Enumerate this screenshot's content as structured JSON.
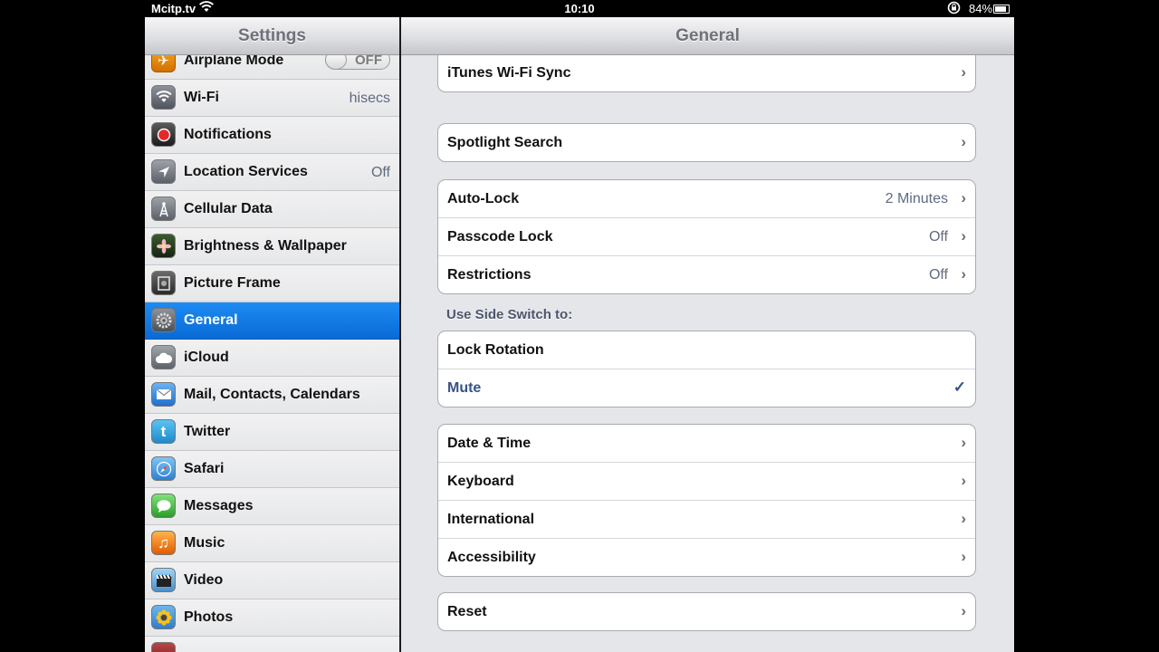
{
  "status_bar": {
    "carrier": "Mcitp.tv",
    "time": "10:10",
    "battery_percent": "84%",
    "battery_level": 0.84,
    "icons": [
      "wifi-icon",
      "rotation-lock-icon",
      "battery-icon"
    ]
  },
  "sidebar": {
    "title": "Settings",
    "items": [
      {
        "label": "Airplane Mode",
        "toggle": "OFF",
        "icon": "airplane-icon"
      },
      {
        "label": "Wi-Fi",
        "value": "hisecs",
        "icon": "wifi-icon"
      },
      {
        "label": "Notifications",
        "icon": "notifications-icon"
      },
      {
        "label": "Location Services",
        "value": "Off",
        "icon": "location-icon"
      },
      {
        "label": "Cellular Data",
        "icon": "antenna-icon"
      },
      {
        "label": "Brightness & Wallpaper",
        "icon": "flower-icon"
      },
      {
        "label": "Picture Frame",
        "icon": "picture-frame-icon"
      },
      {
        "label": "General",
        "icon": "gear-icon",
        "selected": true
      },
      {
        "label": "iCloud",
        "icon": "cloud-icon"
      },
      {
        "label": "Mail, Contacts, Calendars",
        "icon": "mail-icon"
      },
      {
        "label": "Twitter",
        "icon": "twitter-icon"
      },
      {
        "label": "Safari",
        "icon": "compass-icon"
      },
      {
        "label": "Messages",
        "icon": "speech-bubble-icon"
      },
      {
        "label": "Music",
        "icon": "music-icon"
      },
      {
        "label": "Video",
        "icon": "clapperboard-icon"
      },
      {
        "label": "Photos",
        "icon": "sunflower-icon"
      }
    ]
  },
  "detail": {
    "title": "General",
    "group1": [
      {
        "label": "iTunes Wi-Fi Sync"
      }
    ],
    "group2": [
      {
        "label": "Spotlight Search"
      }
    ],
    "group3": [
      {
        "label": "Auto-Lock",
        "value": "2 Minutes"
      },
      {
        "label": "Passcode Lock",
        "value": "Off"
      },
      {
        "label": "Restrictions",
        "value": "Off"
      }
    ],
    "side_switch_header": "Use Side Switch to:",
    "side_switch_options": [
      {
        "label": "Lock Rotation"
      },
      {
        "label": "Mute",
        "checked": true
      }
    ],
    "group5": [
      {
        "label": "Date & Time"
      },
      {
        "label": "Keyboard"
      },
      {
        "label": "International"
      },
      {
        "label": "Accessibility"
      }
    ],
    "group6": [
      {
        "label": "Reset"
      }
    ],
    "chevron": "›",
    "checkmark": "✓"
  },
  "colors": {
    "selection_blue": "#0f78e4",
    "value_text": "#5f6a80",
    "checked_text": "#385487",
    "navbar_title": "#6e7179"
  }
}
